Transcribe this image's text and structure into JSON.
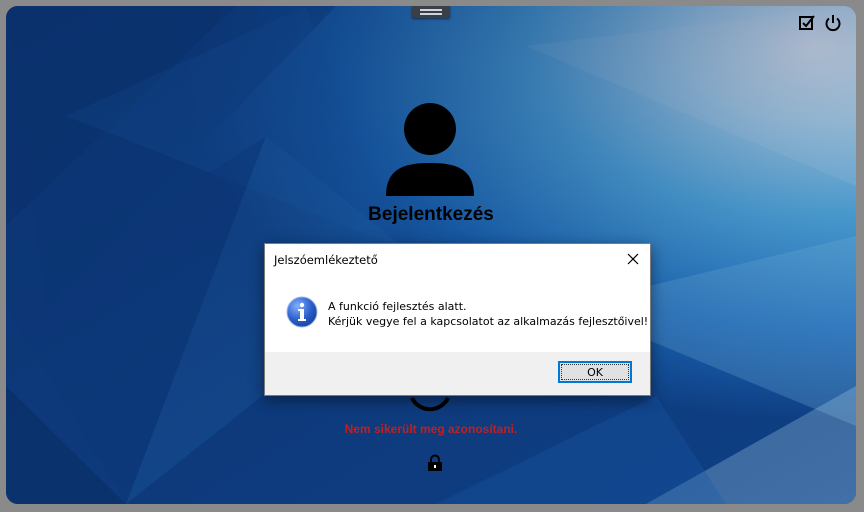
{
  "screen": {
    "title": "Bejelentkezés",
    "error_message": "Nem sikerült meg azonosítani.",
    "icons": {
      "handle": "drag-handle",
      "checkbox": "checkbox-edit-icon",
      "power": "power-icon",
      "avatar": "user-avatar-icon",
      "lock": "lock-icon",
      "fingerprint": "loading-ring-icon"
    }
  },
  "dialog": {
    "title": "Jelszóemlékeztető",
    "message_line1": "A funkció fejlesztés alatt.",
    "message_line2": "Kérjük vegye fel a kapcsolatot az alkalmazás fejlesztőivel!",
    "ok_label": "OK",
    "icon": "info-icon"
  },
  "colors": {
    "error": "#c02020",
    "focus": "#0078d7"
  }
}
